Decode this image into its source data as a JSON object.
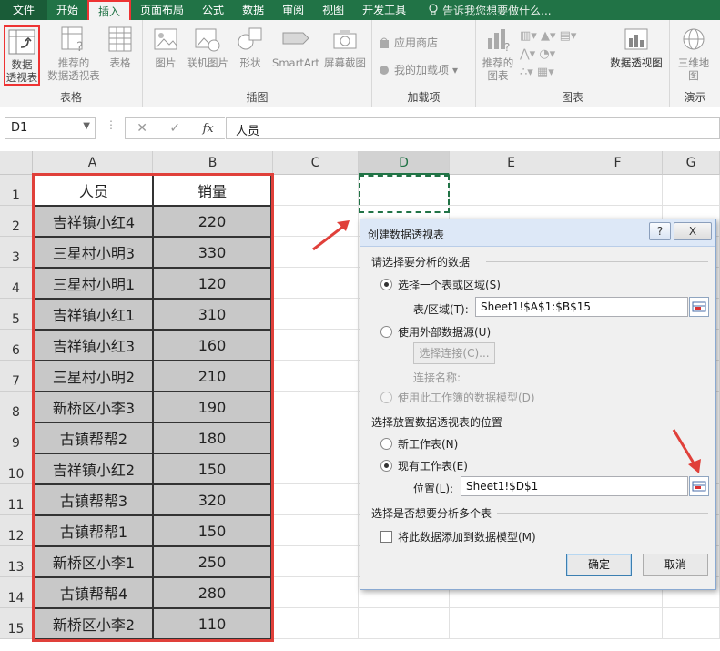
{
  "menubar": {
    "tabs": [
      "文件",
      "开始",
      "插入",
      "页面布局",
      "公式",
      "数据",
      "审阅",
      "视图",
      "开发工具"
    ],
    "active_tab": "插入",
    "tell_me": "告诉我您想要做什么..."
  },
  "ribbon": {
    "groups": {
      "table": "表格",
      "illustrations": "插图",
      "addins": "加载项",
      "charts": "图表",
      "tours": "演示"
    },
    "buttons": {
      "pivot_table": [
        "数据",
        "透视表"
      ],
      "recommended_pivot": [
        "推荐的",
        "数据透视表"
      ],
      "table": "表格",
      "pictures": "图片",
      "online_pictures": "联机图片",
      "shapes": "形状",
      "smartart": "SmartArt",
      "screenshot": "屏幕截图",
      "store": "应用商店",
      "my_addins": "我的加载项",
      "recommended_charts": [
        "推荐的",
        "图表"
      ],
      "pivot_chart": "数据透视图",
      "map_3d": [
        "三维地",
        "图"
      ]
    }
  },
  "formula_bar": {
    "name_box": "D1",
    "content": "人员"
  },
  "columns": [
    "A",
    "B",
    "C",
    "D",
    "E",
    "F",
    "G"
  ],
  "rows": [
    "1",
    "2",
    "3",
    "4",
    "5",
    "6",
    "7",
    "8",
    "9",
    "10",
    "11",
    "12",
    "13",
    "14",
    "15"
  ],
  "table": {
    "headers": [
      "人员",
      "销量"
    ],
    "rows": [
      [
        "吉祥镇小红4",
        "220"
      ],
      [
        "三星村小明3",
        "330"
      ],
      [
        "三星村小明1",
        "120"
      ],
      [
        "吉祥镇小红1",
        "310"
      ],
      [
        "吉祥镇小红3",
        "160"
      ],
      [
        "三星村小明2",
        "210"
      ],
      [
        "新桥区小李3",
        "190"
      ],
      [
        "古镇帮帮2",
        "180"
      ],
      [
        "吉祥镇小红2",
        "150"
      ],
      [
        "古镇帮帮3",
        "320"
      ],
      [
        "古镇帮帮1",
        "150"
      ],
      [
        "新桥区小李1",
        "250"
      ],
      [
        "古镇帮帮4",
        "280"
      ],
      [
        "新桥区小李2",
        "110"
      ]
    ]
  },
  "dialog": {
    "title": "创建数据透视表",
    "help": "?",
    "close": "X",
    "section1": "请选择要分析的数据",
    "opt_select_table": "选择一个表或区域(S)",
    "table_range_label": "表/区域(T):",
    "table_range_value": "Sheet1!$A$1:$B$15",
    "opt_external": "使用外部数据源(U)",
    "choose_connection": "选择连接(C)...",
    "connection_name": "连接名称:",
    "opt_data_model": "使用此工作簿的数据模型(D)",
    "section2": "选择放置数据透视表的位置",
    "opt_new_sheet": "新工作表(N)",
    "opt_existing_sheet": "现有工作表(E)",
    "location_label": "位置(L):",
    "location_value": "Sheet1!$D$1",
    "section3": "选择是否想要分析多个表",
    "add_to_model": "将此数据添加到数据模型(M)",
    "ok": "确定",
    "cancel": "取消"
  },
  "colors": {
    "excel_green": "#217346",
    "highlight_red": "#e0403a",
    "cell_gray": "#c8c8c8"
  }
}
